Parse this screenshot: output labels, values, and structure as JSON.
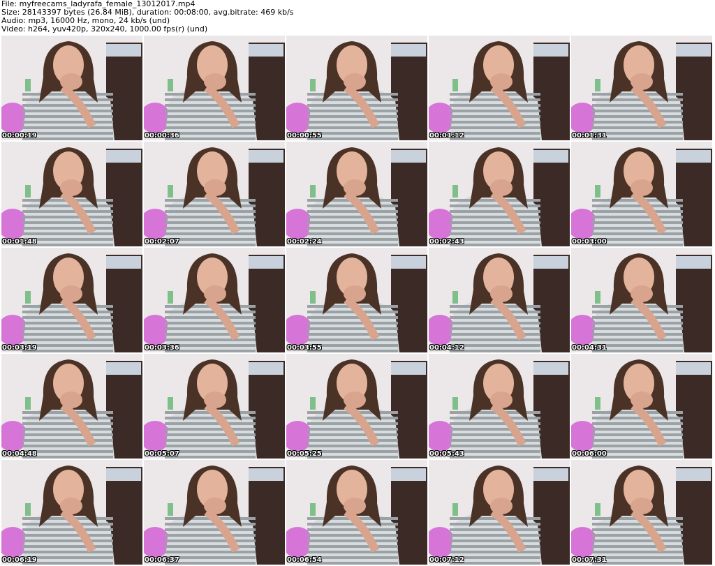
{
  "header": {
    "file_line": "File: myfreecams_ladyrafa_female_13012017.mp4",
    "size_line": "Size: 28143397 bytes (26.84 MiB), duration: 00:08:00, avg.bitrate: 469 kb/s",
    "audio_line": "Audio: mp3, 16000 Hz, mono, 24 kb/s (und)",
    "video_line": "Video: h264, yuv420p, 320x240, 1000.00 fps(r) (und)"
  },
  "thumbnails": [
    {
      "timestamp": "00:00:19"
    },
    {
      "timestamp": "00:00:36"
    },
    {
      "timestamp": "00:00:55"
    },
    {
      "timestamp": "00:01:12"
    },
    {
      "timestamp": "00:01:31"
    },
    {
      "timestamp": "00:01:48"
    },
    {
      "timestamp": "00:02:07"
    },
    {
      "timestamp": "00:02:24"
    },
    {
      "timestamp": "00:02:43"
    },
    {
      "timestamp": "00:03:00"
    },
    {
      "timestamp": "00:03:19"
    },
    {
      "timestamp": "00:03:36"
    },
    {
      "timestamp": "00:03:55"
    },
    {
      "timestamp": "00:04:12"
    },
    {
      "timestamp": "00:04:31"
    },
    {
      "timestamp": "00:04:48"
    },
    {
      "timestamp": "00:05:07"
    },
    {
      "timestamp": "00:05:25"
    },
    {
      "timestamp": "00:05:43"
    },
    {
      "timestamp": "00:06:00"
    },
    {
      "timestamp": "00:06:19"
    },
    {
      "timestamp": "00:06:37"
    },
    {
      "timestamp": "00:06:54"
    },
    {
      "timestamp": "00:07:12"
    },
    {
      "timestamp": "00:07:31"
    }
  ],
  "colors": {
    "background": "#ffffff",
    "wall": "#ece8ea",
    "hair": "#4a3226",
    "skin": "#e3b39c",
    "shirt_stripe_light": "#d8dcdf",
    "shirt_stripe_dark": "#9aa2a6",
    "pink_object": "#d774d8",
    "dark_furniture": "#3b2a25"
  }
}
